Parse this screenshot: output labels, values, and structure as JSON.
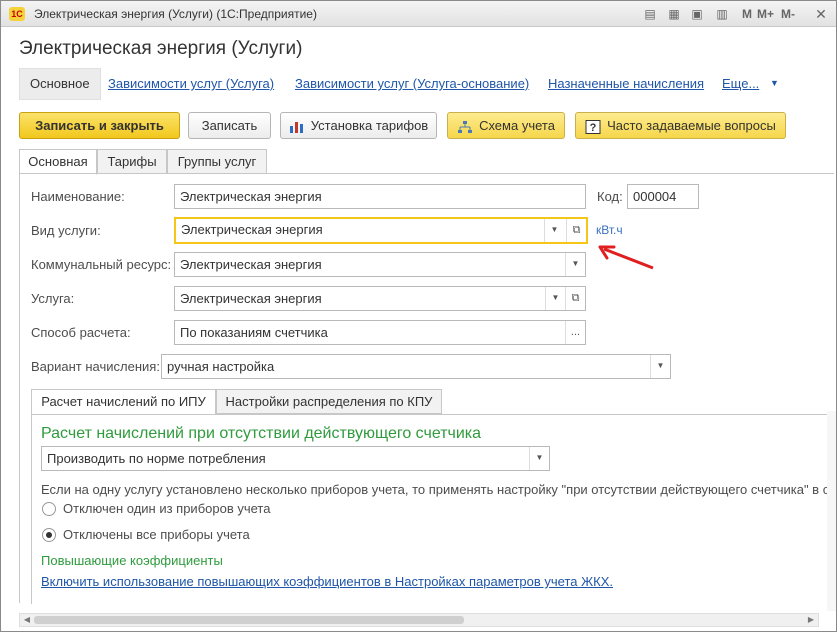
{
  "window": {
    "logo": "1С",
    "title": "Электрическая энергия (Услуги)  (1С:Предприятие)"
  },
  "form": {
    "title": "Электрическая энергия (Услуги)"
  },
  "nav": {
    "active": "Основное",
    "links": [
      "Зависимости услуг (Услуга)",
      "Зависимости услуг (Услуга-основание)",
      "Назначенные начисления",
      "Еще..."
    ]
  },
  "toolbar": {
    "save_close": "Записать и закрыть",
    "save": "Записать",
    "tariffs": "Установка тарифов",
    "scheme": "Схема учета",
    "faq": "Часто задаваемые вопросы"
  },
  "tabs": [
    "Основная",
    "Тарифы",
    "Группы услуг"
  ],
  "fields": {
    "name_label": "Наименование:",
    "name_value": "Электрическая энергия",
    "code_label": "Код:",
    "code_value": "000004",
    "service_type_label": "Вид услуги:",
    "service_type_value": "Электрическая энергия",
    "unit": "кВт.ч",
    "resource_label": "Коммунальный ресурс:",
    "resource_value": "Электрическая энергия",
    "service_label": "Услуга:",
    "service_value": "Электрическая энергия",
    "calc_label": "Способ расчета:",
    "calc_value": "По показаниям счетчика",
    "variant_label": "Вариант начисления:",
    "variant_value": "ручная настройка"
  },
  "subtabs": [
    "Расчет начислений по ИПУ",
    "Настройки распределения по КПУ"
  ],
  "ipu": {
    "heading": "Расчет начислений при отсутствии действующего счетчика",
    "mode_value": "Производить по норме потребления",
    "note": "Если на одну услугу установлено несколько приборов учета, то применять настройку \"при отсутствии действующего счетчика\" в с",
    "radio1": "Отключен один из приборов учета",
    "radio2": "Отключены все приборы учета",
    "coef_heading": "Повышающие коэффициенты",
    "coef_link": "Включить использование повышающих коэффициентов в Настройках параметров учета ЖКХ."
  },
  "colors": {
    "accent_yellow": "#f5c518",
    "green": "#2f9b3d",
    "link_blue": "#1f56a8",
    "arrow_red": "#e02020"
  }
}
